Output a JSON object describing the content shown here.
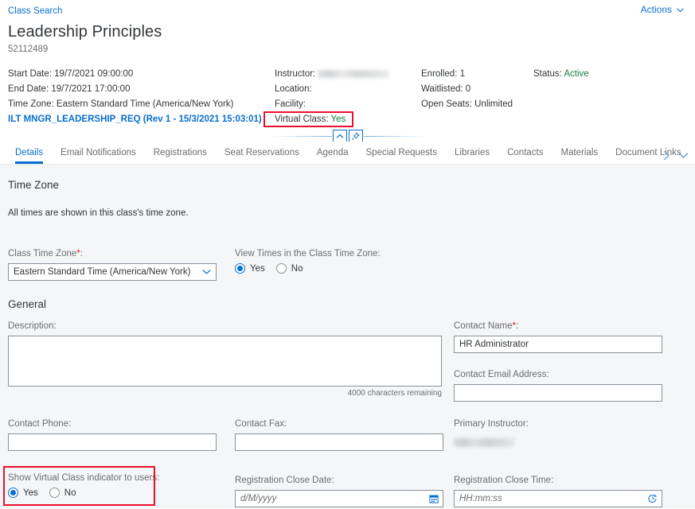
{
  "header": {
    "breadcrumb": "Class Search",
    "actions_label": "Actions",
    "actions_caret": "chevron-down-icon",
    "title": "Leadership Principles",
    "subtitle": "52112489",
    "facts_col1": [
      {
        "label": "Start Date: 19/7/2021 09:00:00"
      },
      {
        "label": "End Date: 19/7/2021 17:00:00"
      },
      {
        "label": "Time Zone: Eastern Standard Time (America/New York)"
      }
    ],
    "curriculum_link": "ILT MNGR_LEADERSHIP_REQ (Rev 1 - 15/3/2021 15:03:01)",
    "facts_col2": [
      {
        "label": "Instructor:",
        "value": "",
        "redacted": true
      },
      {
        "label": "Location:",
        "value": ""
      },
      {
        "label": "Facility:",
        "value": ""
      }
    ],
    "virtual_class_label": "Virtual Class:",
    "virtual_class_value": "Yes",
    "facts_col3": [
      {
        "label": "Enrolled: 1"
      },
      {
        "label": "Waitlisted: 0"
      },
      {
        "label": "Open Seats: Unlimited"
      }
    ],
    "status_label": "Status:",
    "status_value": "Active",
    "collapse_button": "collapse-header-button",
    "pin_button": "pin-header-button"
  },
  "tabs": [
    {
      "label": "Details",
      "active": true
    },
    {
      "label": "Email Notifications",
      "active": false
    },
    {
      "label": "Registrations",
      "active": false
    },
    {
      "label": "Seat Reservations",
      "active": false
    },
    {
      "label": "Agenda",
      "active": false
    },
    {
      "label": "Special Requests",
      "active": false
    },
    {
      "label": "Libraries",
      "active": false
    },
    {
      "label": "Contacts",
      "active": false
    },
    {
      "label": "Materials",
      "active": false
    },
    {
      "label": "Document Links",
      "active": false
    }
  ],
  "time_zone_section": {
    "title": "Time Zone",
    "helper": "All times are shown in this class's time zone.",
    "class_time_zone_label": "Class Time Zone",
    "class_time_zone_value": "Eastern Standard Time (America/New York)",
    "view_times_label": "View Times in the Class Time Zone:",
    "view_times_yes": "Yes",
    "view_times_no": "No",
    "view_times_selected": "Yes"
  },
  "general_section": {
    "title": "General",
    "description_label": "Description:",
    "description_value": "",
    "characters_remaining": "4000 characters remaining",
    "contact_name_label": "Contact Name",
    "contact_name_value": "HR Administrator",
    "contact_email_label": "Contact Email Address:",
    "contact_email_value": "",
    "contact_phone_label": "Contact Phone:",
    "contact_phone_value": "",
    "contact_fax_label": "Contact Fax:",
    "contact_fax_value": "",
    "primary_instructor_label": "Primary Instructor:",
    "primary_instructor_value": "",
    "show_vc_label": "Show Virtual Class indicator to users:",
    "show_vc_yes": "Yes",
    "show_vc_no": "No",
    "show_vc_selected": "Yes",
    "reg_close_date_label": "Registration Close Date:",
    "reg_close_date_placeholder": "d/M/yyyy",
    "reg_close_date_value": "",
    "reg_close_time_label": "Registration Close Time:",
    "reg_close_time_placeholder": "HH:mm:ss",
    "reg_close_time_value": ""
  },
  "colors": {
    "link": "#0a6ed1",
    "status_green": "#107e3e",
    "highlight_red": "#e8112d",
    "content_bg": "#f5f6f7",
    "label_gray": "#6a6d70"
  }
}
